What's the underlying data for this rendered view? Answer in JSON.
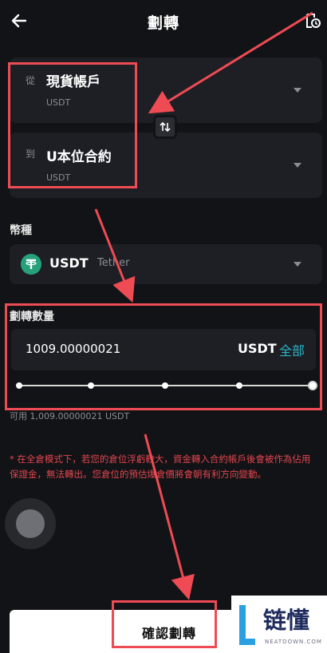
{
  "header": {
    "title": "劃轉",
    "back_icon": "arrow-left-icon",
    "history_icon": "history-icon"
  },
  "transfer": {
    "from": {
      "label": "從",
      "account": "現貨帳戶",
      "coin": "USDT"
    },
    "to": {
      "label": "到",
      "account": "U本位合約",
      "coin": "USDT"
    },
    "swap_icon": "swap-vertical-icon"
  },
  "currency": {
    "label": "幣種",
    "symbol": "USDT",
    "name": "Tether",
    "icon": "tether-icon"
  },
  "amount": {
    "label": "劃轉數量",
    "value": "1009.00000021",
    "unit": "USDT",
    "all_label": "全部",
    "slider_fraction": 1.0,
    "available": "可用 1,009.00000021 USDT"
  },
  "notice": "* 在全倉模式下，若您的倉位浮虧較大，資金轉入合約帳戶後會被作為佔用保證金，無法轉出。您倉位的預估爆倉價將會朝有利方向變動。",
  "confirm_label": "確認劃轉",
  "watermark": {
    "text": "链懂",
    "sub": "NEATDOWN.COM"
  },
  "colors": {
    "accent": "#2bb3c7",
    "annotation": "#ef4b54",
    "warning": "#e0464f",
    "tether": "#26a17b"
  }
}
